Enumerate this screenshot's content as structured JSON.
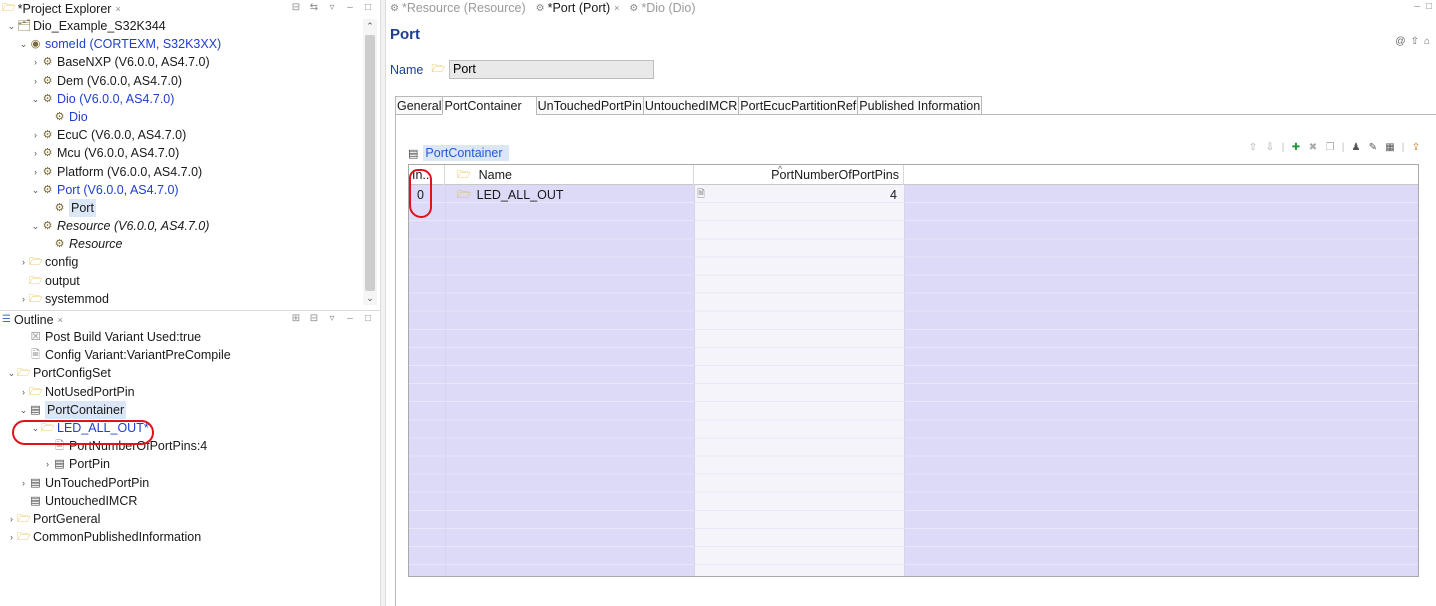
{
  "project_explorer": {
    "title": "*Project Explorer",
    "items": [
      {
        "label": "Dio_Example_S32K344",
        "depth": 0,
        "twisty": "open",
        "icon": "project-icon",
        "style": "normal"
      },
      {
        "label": "someId (CORTEXM, S32K3XX)",
        "depth": 1,
        "twisty": "open",
        "icon": "target-icon",
        "style": "blue"
      },
      {
        "label": "BaseNXP (V6.0.0, AS4.7.0)",
        "depth": 2,
        "twisty": "closed",
        "icon": "module-icon",
        "style": "normal"
      },
      {
        "label": "Dem (V6.0.0, AS4.7.0)",
        "depth": 2,
        "twisty": "closed",
        "icon": "module-icon",
        "style": "normal"
      },
      {
        "label": "Dio (V6.0.0, AS4.7.0)",
        "depth": 2,
        "twisty": "open",
        "icon": "module-icon",
        "style": "blue"
      },
      {
        "label": "Dio",
        "depth": 3,
        "twisty": "none",
        "icon": "config-icon",
        "style": "blue"
      },
      {
        "label": "EcuC (V6.0.0, AS4.7.0)",
        "depth": 2,
        "twisty": "closed",
        "icon": "module-icon",
        "style": "normal"
      },
      {
        "label": "Mcu (V6.0.0, AS4.7.0)",
        "depth": 2,
        "twisty": "closed",
        "icon": "module-icon",
        "style": "normal"
      },
      {
        "label": "Platform (V6.0.0, AS4.7.0)",
        "depth": 2,
        "twisty": "closed",
        "icon": "module-icon",
        "style": "normal"
      },
      {
        "label": "Port (V6.0.0, AS4.7.0)",
        "depth": 2,
        "twisty": "open",
        "icon": "module-icon",
        "style": "blue"
      },
      {
        "label": "Port",
        "depth": 3,
        "twisty": "none",
        "icon": "config-icon",
        "style": "selected"
      },
      {
        "label": "Resource (V6.0.0, AS4.7.0)",
        "depth": 2,
        "twisty": "open",
        "icon": "module-icon",
        "style": "italic"
      },
      {
        "label": "Resource",
        "depth": 3,
        "twisty": "none",
        "icon": "config-icon",
        "style": "italic"
      },
      {
        "label": "config",
        "depth": 1,
        "twisty": "closed",
        "icon": "folder-icon",
        "style": "normal"
      },
      {
        "label": "output",
        "depth": 1,
        "twisty": "none",
        "icon": "folder-icon",
        "style": "normal"
      },
      {
        "label": "systemmod",
        "depth": 1,
        "twisty": "closed",
        "icon": "folder-icon",
        "style": "normal"
      }
    ]
  },
  "outline": {
    "title": "Outline",
    "items": [
      {
        "label": "Post Build Variant Used:true",
        "depth": 1,
        "twisty": "none",
        "icon": "checkbox-icon",
        "style": "normal"
      },
      {
        "label": "Config Variant:VariantPreCompile",
        "depth": 1,
        "twisty": "none",
        "icon": "doc-icon",
        "style": "normal"
      },
      {
        "label": "PortConfigSet",
        "depth": 0,
        "twisty": "open",
        "icon": "folder-icon",
        "style": "normal"
      },
      {
        "label": "NotUsedPortPin",
        "depth": 1,
        "twisty": "closed",
        "icon": "folder-icon",
        "style": "normal"
      },
      {
        "label": "PortContainer",
        "depth": 1,
        "twisty": "open",
        "icon": "table-icon",
        "style": "selected"
      },
      {
        "label": "LED_ALL_OUT*",
        "depth": 2,
        "twisty": "open",
        "icon": "folder-icon",
        "style": "blue"
      },
      {
        "label": "PortNumberOfPortPins:4",
        "depth": 3,
        "twisty": "none",
        "icon": "doc-icon",
        "style": "normal"
      },
      {
        "label": "PortPin",
        "depth": 3,
        "twisty": "closed",
        "icon": "table-icon",
        "style": "normal"
      },
      {
        "label": "UnTouchedPortPin",
        "depth": 1,
        "twisty": "closed",
        "icon": "table-icon",
        "style": "normal"
      },
      {
        "label": "UntouchedIMCR",
        "depth": 1,
        "twisty": "none",
        "icon": "table-icon",
        "style": "normal"
      },
      {
        "label": "PortGeneral",
        "depth": 0,
        "twisty": "closed",
        "icon": "folder-icon",
        "style": "normal"
      },
      {
        "label": "CommonPublishedInformation",
        "depth": 0,
        "twisty": "closed",
        "icon": "folder-icon",
        "style": "normal"
      }
    ]
  },
  "editor_tabs": [
    {
      "label": "*Resource (Resource)",
      "active": false,
      "closable": false
    },
    {
      "label": "*Port (Port)",
      "active": true,
      "closable": true
    },
    {
      "label": "*Dio (Dio)",
      "active": false,
      "closable": false
    }
  ],
  "editor": {
    "title": "Port",
    "name_label": "Name",
    "name_value": "Port",
    "param_tabs": [
      {
        "label": "General",
        "active": false
      },
      {
        "label": "PortContainer",
        "active": true
      },
      {
        "label": "UnTouchedPortPin",
        "active": false
      },
      {
        "label": "UntouchedIMCR",
        "active": false
      },
      {
        "label": "PortEcucPartitionRef",
        "active": false
      },
      {
        "label": "Published Information",
        "active": false
      }
    ],
    "container_label": "PortContainer",
    "table": {
      "headers": {
        "index": "In...",
        "name": "Name",
        "number": "PortNumberOfPortPins"
      },
      "rows": [
        {
          "index": "0",
          "name": "LED_ALL_OUT",
          "number": "4"
        }
      ]
    }
  },
  "colors": {
    "annotation": "#e0121a",
    "title_blue": "#1c3f94",
    "link_blue": "#1f3ecf",
    "grid_fill": "#dcdaf6",
    "selection": "#dbe6f6"
  }
}
